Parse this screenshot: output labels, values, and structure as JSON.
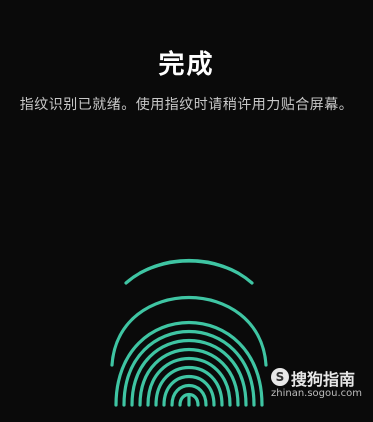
{
  "screen": {
    "title": "完成",
    "subtitle": "指纹识别已就绪。使用指纹时请稍许用力贴合屏幕。"
  },
  "fingerprint": {
    "icon": "fingerprint-icon",
    "color": "#3fc5a3"
  },
  "watermark": {
    "brand": "搜狗指南",
    "url": "zhinan.sogou.com",
    "logo_glyph": "S"
  },
  "colors": {
    "background": "#0a0a0a",
    "title": "#ffffff",
    "subtitle": "#c8c8c8",
    "accent": "#3fc5a3"
  }
}
